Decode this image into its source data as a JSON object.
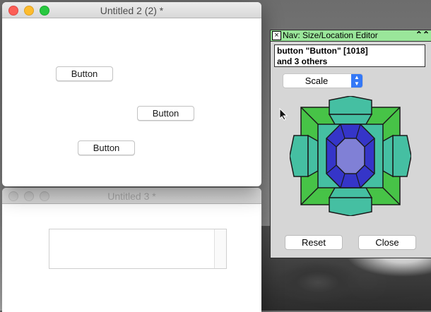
{
  "windows": {
    "front": {
      "title": "Untitled 2 (2) *",
      "buttons": [
        "Button",
        "Button",
        "Button"
      ]
    },
    "back": {
      "title": "Untitled 3 *"
    }
  },
  "palette": {
    "title": "Nav: Size/Location Editor",
    "selection_line1": "button \"Button\" [1018]",
    "selection_line2": "and 3 others",
    "mode": "Scale",
    "reset_label": "Reset",
    "close_label": "Close",
    "colors": {
      "outer_green": "#47c347",
      "teal": "#45bfa2",
      "blue": "#3535c8",
      "center": "#8080d6",
      "title_bg": "#9ae69a"
    }
  },
  "icons": {
    "palette_close": "close-box-icon",
    "collapse": "collapse-arrows-icon",
    "select_arrows": "updown-arrows-icon",
    "cursor": "pointer-cursor-icon"
  }
}
